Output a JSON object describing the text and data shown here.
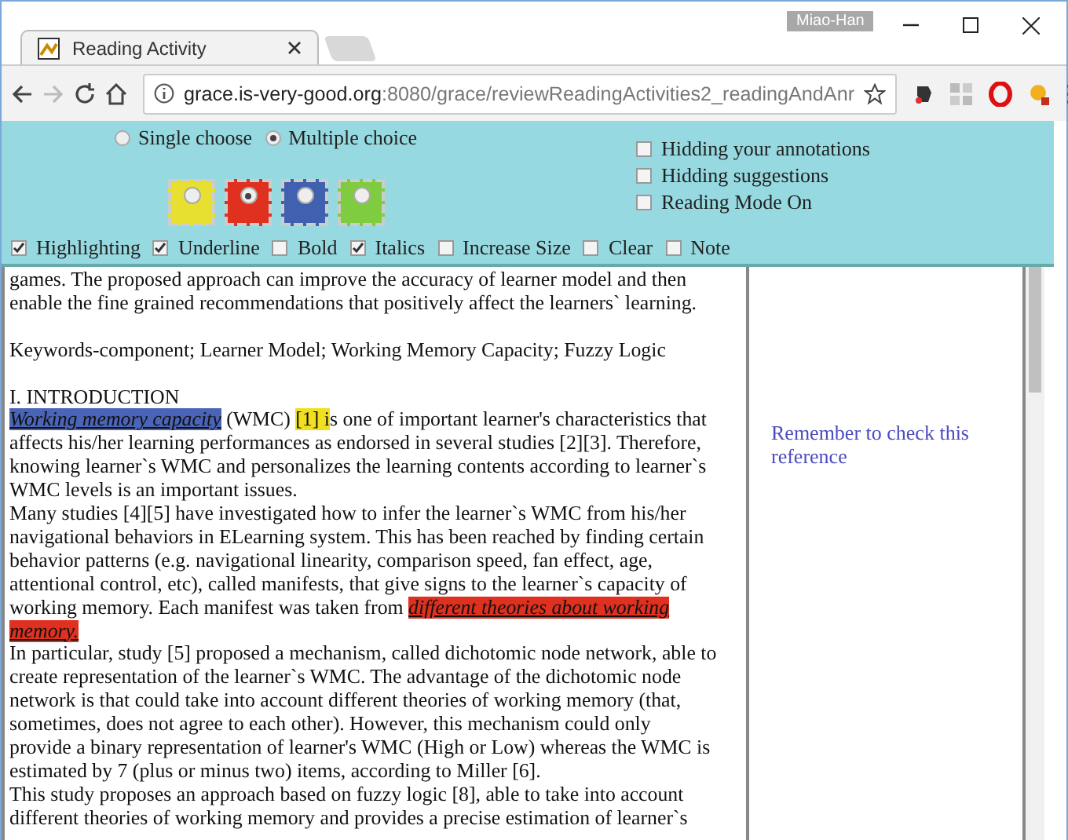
{
  "window": {
    "user": "Miao-Han"
  },
  "tabs": [
    {
      "title": "Reading Activity",
      "selected": true
    }
  ],
  "address": {
    "host": "grace.is-very-good.org",
    "path": ":8080/grace/reviewReadingActivities2_readingAndAnr"
  },
  "toolbar": {
    "modes": [
      {
        "label": "Single choose",
        "selected": false
      },
      {
        "label": "Multiple choice",
        "selected": true
      }
    ],
    "colors": [
      {
        "color": "#e8e030",
        "selected": false
      },
      {
        "color": "#e03020",
        "selected": true
      },
      {
        "color": "#4060b0",
        "selected": false
      },
      {
        "color": "#80cc40",
        "selected": false
      }
    ],
    "options": [
      {
        "label": "Hidding your annotations",
        "checked": false
      },
      {
        "label": "Hidding suggestions",
        "checked": false
      },
      {
        "label": "Reading Mode On",
        "checked": false
      }
    ],
    "styles": [
      {
        "label": "Highlighting",
        "checked": true
      },
      {
        "label": "Underline",
        "checked": true
      },
      {
        "label": "Bold",
        "checked": false
      },
      {
        "label": "Italics",
        "checked": true
      },
      {
        "label": "Increase Size",
        "checked": false
      },
      {
        "label": "Clear",
        "checked": false
      },
      {
        "label": "Note",
        "checked": false
      }
    ]
  },
  "document": {
    "blocks": [
      {
        "lines": [
          {
            "segments": [
              {
                "text": "games. The proposed approach can improve the accuracy of learner model and then"
              }
            ]
          },
          {
            "segments": [
              {
                "text": "enable the fine grained recommendations that positively affect the learners` learning."
              }
            ]
          }
        ]
      },
      {
        "lines": [
          {
            "segments": [
              {
                "text": "Keywords-component; Learner Model; Working Memory Capacity; Fuzzy Logic"
              }
            ]
          }
        ]
      },
      {
        "lines": [
          {
            "segments": [
              {
                "text": "I. INTRODUCTION"
              }
            ]
          },
          {
            "segments": [
              {
                "text": "Working memory capacity",
                "color": "#4a64b8",
                "italic": true,
                "underline": true
              },
              {
                "text": " (WMC) "
              },
              {
                "text": "[1] i",
                "color": "#f0e020"
              },
              {
                "text": "s one of important learner's characteristics that"
              }
            ]
          },
          {
            "segments": [
              {
                "text": "affects his/her learning performances as endorsed in several studies [2][3]. Therefore,"
              }
            ]
          },
          {
            "segments": [
              {
                "text": "knowing learner`s WMC and personalizes the learning contents according to learner`s"
              }
            ]
          },
          {
            "segments": [
              {
                "text": "WMC levels is an important issues."
              }
            ]
          },
          {
            "segments": [
              {
                "text": "Many studies [4][5] have investigated how to infer the learner`s WMC from his/her"
              }
            ]
          },
          {
            "segments": [
              {
                "text": "navigational behaviors in ELearning system. This has been reached by finding certain"
              }
            ]
          },
          {
            "segments": [
              {
                "text": "behavior patterns (e.g. navigational linearity, comparison speed, fan effect, age,"
              }
            ]
          },
          {
            "segments": [
              {
                "text": "attentional control, etc), called manifests, that give signs to the learner`s capacity of"
              }
            ]
          },
          {
            "segments": [
              {
                "text": "working memory. Each manifest was taken from "
              },
              {
                "text": "different theories about working",
                "color": "#e03020",
                "italic": true,
                "underline": true
              }
            ]
          },
          {
            "segments": [
              {
                "text": "memory.",
                "color": "#e03020",
                "italic": true,
                "underline": true
              }
            ]
          },
          {
            "segments": [
              {
                "text": "In particular, study [5] proposed a mechanism, called dichotomic node network, able to"
              }
            ]
          },
          {
            "segments": [
              {
                "text": "create representation of the learner`s WMC. The advantage of the dichotomic node"
              }
            ]
          },
          {
            "segments": [
              {
                "text": "network is that could take into account different theories of working memory (that,"
              }
            ]
          },
          {
            "segments": [
              {
                "text": "sometimes, does not agree to each other). However, this mechanism could only"
              }
            ]
          },
          {
            "segments": [
              {
                "text": "provide a binary representation of learner's WMC (High or Low) whereas the WMC is"
              }
            ]
          },
          {
            "segments": [
              {
                "text": "estimated by 7 (plus or minus two) items, according to Miller [6]."
              }
            ]
          },
          {
            "segments": [
              {
                "text": "This study proposes an approach based on fuzzy logic [8], able to take into account"
              }
            ]
          },
          {
            "segments": [
              {
                "text": "different theories of working memory and provides a precise estimation of learner`s"
              }
            ]
          }
        ]
      }
    ]
  },
  "side_note": {
    "text": "Remember to check this reference"
  }
}
